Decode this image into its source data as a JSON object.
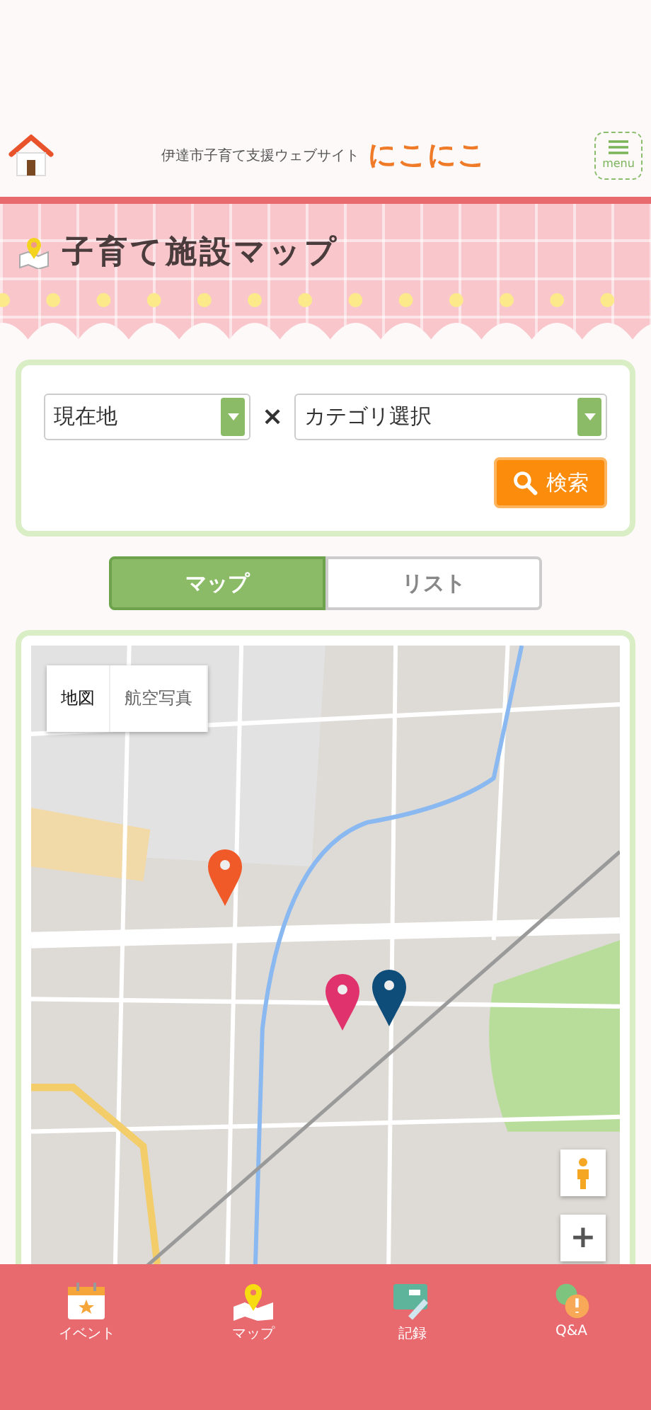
{
  "header": {
    "subtitle": "伊達市子育て支援ウェブサイト",
    "logo": "にこにこ",
    "menu_label": "menu"
  },
  "page_title": "子育て施設マップ",
  "search": {
    "location": "現在地",
    "separator": "×",
    "category": "カテゴリ選択",
    "button": "検索"
  },
  "view_tabs": [
    {
      "label": "マップ",
      "selected": true
    },
    {
      "label": "リスト",
      "selected": false
    }
  ],
  "map": {
    "kind": "picture",
    "map_types": [
      {
        "label": "地図",
        "selected": true
      },
      {
        "label": "航空写真",
        "selected": false
      }
    ],
    "pins": [
      {
        "color": "#f05a28"
      },
      {
        "color": "#e0336e"
      },
      {
        "color": "#0e4d7a"
      }
    ],
    "zoom_in": "+"
  },
  "bottom_nav": [
    {
      "label": "イベント",
      "kind": "calendar"
    },
    {
      "label": "マップ",
      "kind": "map"
    },
    {
      "label": "記録",
      "kind": "record"
    },
    {
      "label": "Q&A",
      "kind": "qa"
    }
  ]
}
